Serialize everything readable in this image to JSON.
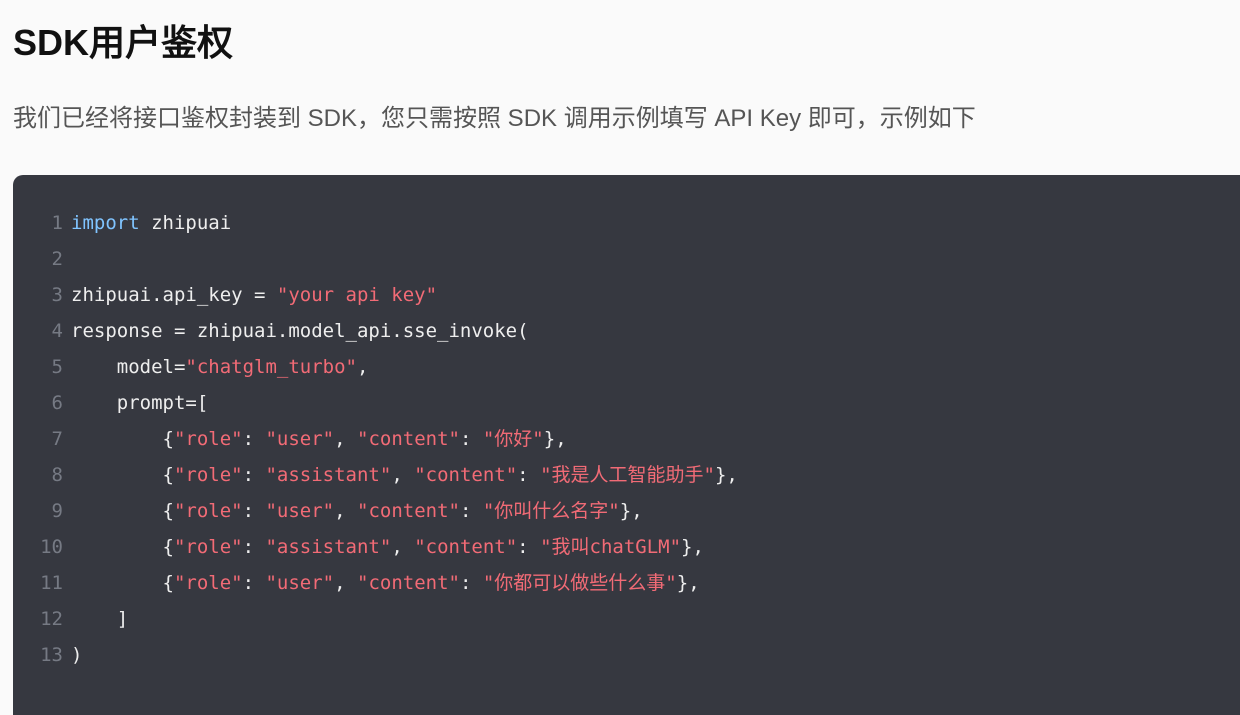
{
  "header": {
    "title": "SDK用户鉴权"
  },
  "intro": {
    "text": "我们已经将接口鉴权封装到 SDK，您只需按照 SDK 调用示例填写 API Key 即可，示例如下"
  },
  "code": {
    "colors": {
      "background": "#363840",
      "keyword": "#80c4ff",
      "string": "#f26b76",
      "text": "#eeeeee",
      "line_number": "#767a84"
    },
    "lines": [
      {
        "n": "1",
        "tokens": [
          {
            "t": "import",
            "c": "kw"
          },
          {
            "t": " zhipuai",
            "c": ""
          }
        ]
      },
      {
        "n": "2",
        "tokens": []
      },
      {
        "n": "3",
        "tokens": [
          {
            "t": "zhipuai.api_key = ",
            "c": ""
          },
          {
            "t": "\"your api key\"",
            "c": "str"
          }
        ]
      },
      {
        "n": "4",
        "tokens": [
          {
            "t": "response = zhipuai.model_api.sse_invoke(",
            "c": ""
          }
        ]
      },
      {
        "n": "5",
        "tokens": [
          {
            "t": "    model=",
            "c": ""
          },
          {
            "t": "\"chatglm_turbo\"",
            "c": "str"
          },
          {
            "t": ",",
            "c": ""
          }
        ]
      },
      {
        "n": "6",
        "tokens": [
          {
            "t": "    prompt=[",
            "c": ""
          }
        ]
      },
      {
        "n": "7",
        "tokens": [
          {
            "t": "        {",
            "c": ""
          },
          {
            "t": "\"role\"",
            "c": "str"
          },
          {
            "t": ": ",
            "c": ""
          },
          {
            "t": "\"user\"",
            "c": "str"
          },
          {
            "t": ", ",
            "c": ""
          },
          {
            "t": "\"content\"",
            "c": "str"
          },
          {
            "t": ": ",
            "c": ""
          },
          {
            "t": "\"你好\"",
            "c": "str"
          },
          {
            "t": "},",
            "c": ""
          }
        ]
      },
      {
        "n": "8",
        "tokens": [
          {
            "t": "        {",
            "c": ""
          },
          {
            "t": "\"role\"",
            "c": "str"
          },
          {
            "t": ": ",
            "c": ""
          },
          {
            "t": "\"assistant\"",
            "c": "str"
          },
          {
            "t": ", ",
            "c": ""
          },
          {
            "t": "\"content\"",
            "c": "str"
          },
          {
            "t": ": ",
            "c": ""
          },
          {
            "t": "\"我是人工智能助手\"",
            "c": "str"
          },
          {
            "t": "},",
            "c": ""
          }
        ]
      },
      {
        "n": "9",
        "tokens": [
          {
            "t": "        {",
            "c": ""
          },
          {
            "t": "\"role\"",
            "c": "str"
          },
          {
            "t": ": ",
            "c": ""
          },
          {
            "t": "\"user\"",
            "c": "str"
          },
          {
            "t": ", ",
            "c": ""
          },
          {
            "t": "\"content\"",
            "c": "str"
          },
          {
            "t": ": ",
            "c": ""
          },
          {
            "t": "\"你叫什么名字\"",
            "c": "str"
          },
          {
            "t": "},",
            "c": ""
          }
        ]
      },
      {
        "n": "10",
        "tokens": [
          {
            "t": "        {",
            "c": ""
          },
          {
            "t": "\"role\"",
            "c": "str"
          },
          {
            "t": ": ",
            "c": ""
          },
          {
            "t": "\"assistant\"",
            "c": "str"
          },
          {
            "t": ", ",
            "c": ""
          },
          {
            "t": "\"content\"",
            "c": "str"
          },
          {
            "t": ": ",
            "c": ""
          },
          {
            "t": "\"我叫chatGLM\"",
            "c": "str"
          },
          {
            "t": "},",
            "c": ""
          }
        ]
      },
      {
        "n": "11",
        "tokens": [
          {
            "t": "        {",
            "c": ""
          },
          {
            "t": "\"role\"",
            "c": "str"
          },
          {
            "t": ": ",
            "c": ""
          },
          {
            "t": "\"user\"",
            "c": "str"
          },
          {
            "t": ", ",
            "c": ""
          },
          {
            "t": "\"content\"",
            "c": "str"
          },
          {
            "t": ": ",
            "c": ""
          },
          {
            "t": "\"你都可以做些什么事\"",
            "c": "str"
          },
          {
            "t": "},",
            "c": ""
          }
        ]
      },
      {
        "n": "12",
        "tokens": [
          {
            "t": "    ]",
            "c": ""
          }
        ]
      },
      {
        "n": "13",
        "tokens": [
          {
            "t": ")",
            "c": ""
          }
        ]
      }
    ]
  }
}
